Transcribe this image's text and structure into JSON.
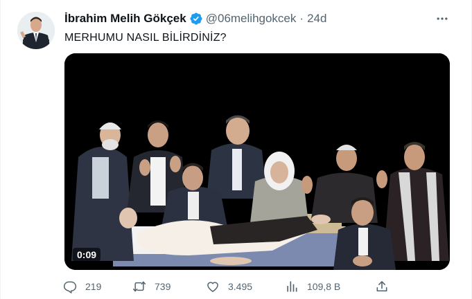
{
  "tweet": {
    "display_name": "İbrahim Melih Gökçek",
    "handle": "@06melihgokcek",
    "separator": "·",
    "time": "24d",
    "text": "MERHUMU NASIL BİLİRDİNİZ?",
    "verified": true
  },
  "media": {
    "type": "video",
    "duration": "0:09"
  },
  "actions": {
    "reply_count": "219",
    "retweet_count": "739",
    "like_count": "3.495",
    "views_count": "109,8 B"
  },
  "icons": {
    "verified": "verified-badge-icon",
    "more": "more-dots-icon",
    "reply": "reply-icon",
    "retweet": "retweet-icon",
    "like": "heart-icon",
    "views": "views-chart-icon",
    "share": "share-icon"
  },
  "colors": {
    "verified": "#1d9bf0",
    "secondary_text": "#536471",
    "primary_text": "#0f1419"
  }
}
